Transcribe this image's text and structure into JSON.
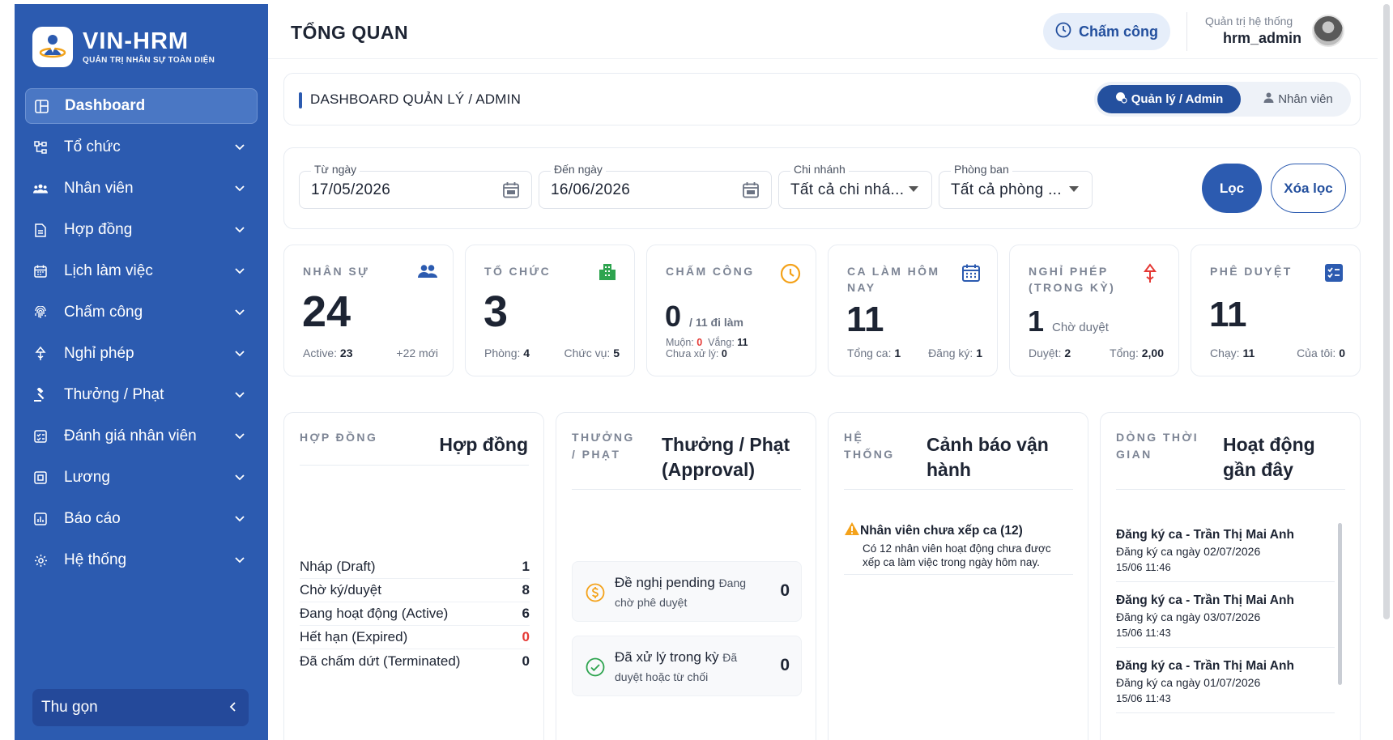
{
  "brand": {
    "title": "VIN-HRM",
    "subtitle": "QUẢN TRỊ NHÂN SỰ TOÀN DIỆN"
  },
  "sidebar": {
    "items": [
      {
        "label": "Dashboard",
        "icon": "dashboard-icon",
        "active": true
      },
      {
        "label": "Tổ chức",
        "icon": "org-icon"
      },
      {
        "label": "Nhân viên",
        "icon": "people-icon"
      },
      {
        "label": "Hợp đồng",
        "icon": "document-icon"
      },
      {
        "label": "Lịch làm việc",
        "icon": "calendar-icon"
      },
      {
        "label": "Chấm công",
        "icon": "fingerprint-icon"
      },
      {
        "label": "Nghỉ phép",
        "icon": "leave-icon"
      },
      {
        "label": "Thưởng / Phạt",
        "icon": "gavel-icon"
      },
      {
        "label": "Đánh giá nhân viên",
        "icon": "review-icon"
      },
      {
        "label": "Lương",
        "icon": "salary-icon"
      },
      {
        "label": "Báo cáo",
        "icon": "report-icon"
      },
      {
        "label": "Hệ thống",
        "icon": "gear-icon"
      }
    ],
    "collapse_label": "Thu gọn"
  },
  "header": {
    "title": "TỔNG QUAN",
    "checkin_label": "Chấm công",
    "user_role": "Quản trị hệ thống",
    "user_name": "hrm_admin"
  },
  "breadcrumb": {
    "text": "DASHBOARD QUẢN LÝ / ADMIN",
    "mode_admin": "Quản lý / Admin",
    "mode_employee": "Nhân viên"
  },
  "filters": {
    "from_label": "Từ ngày",
    "from_value": "17/05/2026",
    "to_label": "Đến ngày",
    "to_value": "16/06/2026",
    "branch_label": "Chi nhánh",
    "branch_value": "Tất cả chi nhá...",
    "dept_label": "Phòng ban",
    "dept_value": "Tất cả phòng ...",
    "filter_button": "Lọc",
    "clear_button": "Xóa lọc"
  },
  "stats": {
    "staff": {
      "label": "NHÂN SỰ",
      "value": "24",
      "active_label": "Active:",
      "active": "23",
      "new": "+22 mới"
    },
    "org": {
      "label": "TỔ CHỨC",
      "value": "3",
      "dept_label": "Phòng:",
      "dept": "4",
      "pos_label": "Chức vụ:",
      "pos": "5"
    },
    "attendance": {
      "label": "CHẤM CÔNG",
      "value": "0",
      "suffix": "/ 11 đi làm",
      "late_label": "Muộn:",
      "late": "0",
      "absent_label": "Vắng:",
      "absent": "11",
      "pending_label": "Chưa xử lý:",
      "pending": "0"
    },
    "shifts": {
      "label_1": "CA LÀM HÔM",
      "label_2": "NAY",
      "value": "11",
      "total_label": "Tổng ca:",
      "total": "1",
      "reg_label": "Đăng ký:",
      "reg": "1"
    },
    "leave": {
      "label_1": "NGHỈ PHÉP",
      "label_2": "(TRONG KỲ)",
      "value": "1",
      "suffix": "Chờ duyệt",
      "approved_label": "Duyệt:",
      "approved": "2",
      "total_label": "Tổng:",
      "total": "2,00"
    },
    "approval": {
      "label": "PHÊ DUYỆT",
      "value": "11",
      "run_label": "Chạy:",
      "run": "11",
      "mine_label": "Của tôi:",
      "mine": "0"
    }
  },
  "panels": {
    "contracts": {
      "kicker": "HỢP ĐỒNG",
      "title": "Hợp đồng",
      "rows": [
        {
          "label": "Nháp (Draft)",
          "value": "1"
        },
        {
          "label": "Chờ ký/duyệt",
          "value": "8"
        },
        {
          "label": "Đang hoạt động (Active)",
          "value": "6"
        },
        {
          "label": "Hết hạn (Expired)",
          "value": "0"
        },
        {
          "label": "Đã chấm dứt (Terminated)",
          "value": "0"
        }
      ]
    },
    "rewards": {
      "kicker_1": "THƯỞNG",
      "kicker_2": "/ PHẠT",
      "title_1": "Thưởng / Phạt",
      "title_2": "(Approval)",
      "pending_title": "Đề nghị pending",
      "pending_note_1": "Đang",
      "pending_note_2": "chờ phê duyệt",
      "pending_value": "0",
      "done_title": "Đã xử lý trong kỳ",
      "done_note_1": "Đã",
      "done_note_2": "duyệt hoặc từ chối",
      "done_value": "0"
    },
    "system": {
      "kicker_1": "HỆ",
      "kicker_2": "THỐNG",
      "title_1": "Cảnh báo vận",
      "title_2": "hành",
      "alert_title": "Nhân viên chưa xếp ca (12)",
      "alert_line_1": "Có 12 nhân viên hoạt động chưa được",
      "alert_line_2": "xếp ca làm việc trong ngày hôm nay."
    },
    "timeline": {
      "kicker_1": "DÒNG THỜI",
      "kicker_2": "GIAN",
      "title_1": "Hoạt động",
      "title_2": "gần đây",
      "items": [
        {
          "title": "Đăng ký ca - Trần Thị Mai Anh",
          "desc": "Đăng ký ca ngày 02/07/2026",
          "time": "15/06 11:46"
        },
        {
          "title": "Đăng ký ca - Trần Thị Mai Anh",
          "desc": "Đăng ký ca ngày 03/07/2026",
          "time": "15/06 11:43"
        },
        {
          "title": "Đăng ký ca - Trần Thị Mai Anh",
          "desc": "Đăng ký ca ngày 01/07/2026",
          "time": "15/06 11:43"
        }
      ]
    }
  },
  "colors": {
    "primary": "#2c5bb0",
    "danger": "#e53935",
    "warning": "#f4a21a",
    "success": "#2ea44f"
  }
}
